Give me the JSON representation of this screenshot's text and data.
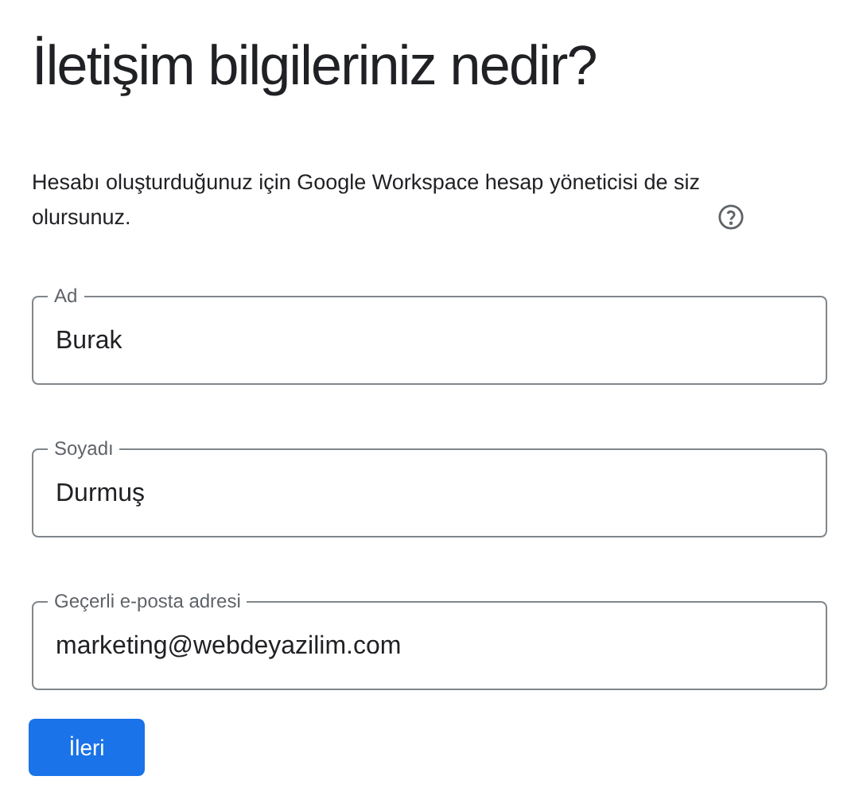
{
  "title": "İletişim bilgileriniz nedir?",
  "description": "Hesabı oluşturduğunuz için Google Workspace hesap yöneticisi de siz olursunuz.",
  "fields": [
    {
      "label": "Ad",
      "value": "Burak"
    },
    {
      "label": "Soyadı",
      "value": "Durmuş"
    },
    {
      "label": "Geçerli e-posta adresi",
      "value": "marketing@webdeyazilim.com"
    }
  ],
  "button": "İleri"
}
